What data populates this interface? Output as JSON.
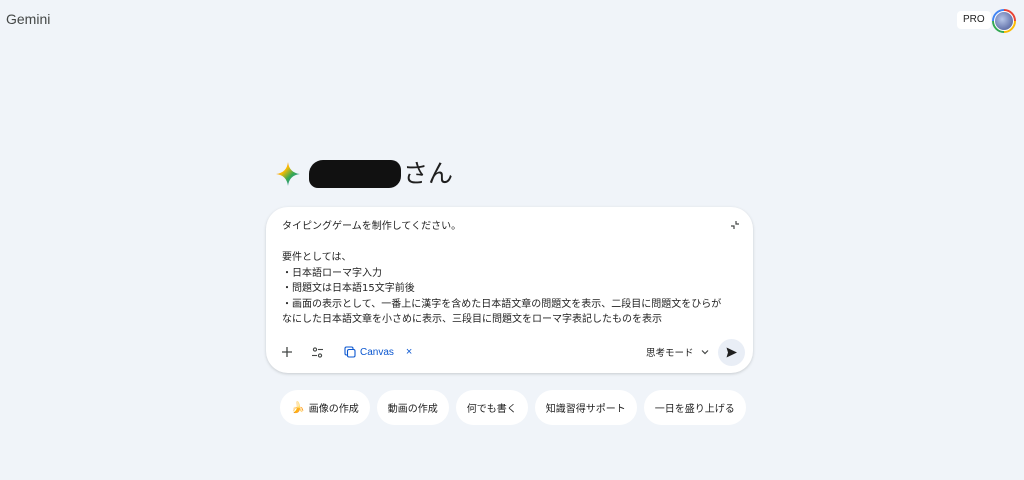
{
  "app": {
    "title": "Gemini",
    "plan_badge": "PRO"
  },
  "greeting": {
    "suffix": "さん"
  },
  "prompt": {
    "text": "タイピングゲームを制作してください。\n\n要件としては、\n・日本語ローマ字入力\n・問題文は日本語15文字前後\n・画面の表示として、一番上に漢字を含めた日本語文章の問題文を表示、二段目に問題文をひらがなにした日本語文章を小さめに表示、三段目に問題文をローマ字表記したものを表示"
  },
  "toolbar": {
    "add_icon": "plus-icon",
    "tools_icon": "tune-icon",
    "canvas_label": "Canvas",
    "canvas_close": "×",
    "mode_label": "思考モード",
    "send_icon": "send-icon"
  },
  "suggestions": [
    {
      "label": "画像の作成",
      "icon": "banana-icon"
    },
    {
      "label": "動画の作成"
    },
    {
      "label": "何でも書く"
    },
    {
      "label": "知識習得サポート"
    },
    {
      "label": "一日を盛り上げる"
    }
  ],
  "colors": {
    "background": "#f0f4f9",
    "card": "#ffffff",
    "accent": "#0b57d0"
  }
}
